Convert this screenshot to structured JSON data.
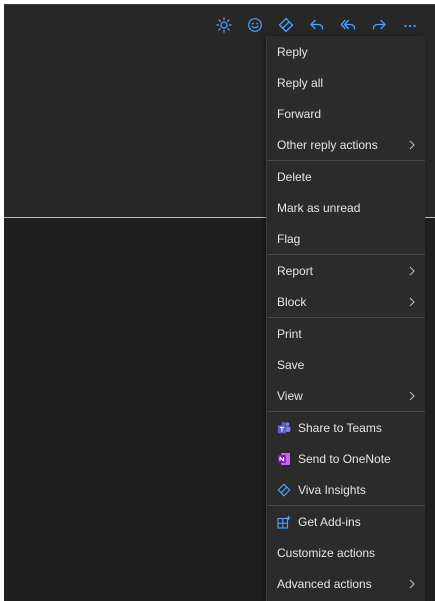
{
  "toolbar": {
    "icons": [
      "sun-icon",
      "emoji-icon",
      "viva-insights-icon",
      "reply-icon",
      "reply-all-icon",
      "forward-icon",
      "more-icon"
    ],
    "accent_color": "#4aa3ff"
  },
  "menu": {
    "reply": "Reply",
    "reply_all": "Reply all",
    "forward": "Forward",
    "other_reply_actions": "Other reply actions",
    "delete": "Delete",
    "mark_as_unread": "Mark as unread",
    "flag": "Flag",
    "report": "Report",
    "block": "Block",
    "print": "Print",
    "save": "Save",
    "view": "View",
    "share_to_teams": "Share to Teams",
    "send_to_onenote": "Send to OneNote",
    "viva_insights": "Viva Insights",
    "get_add_ins": "Get Add-ins",
    "customize_actions": "Customize actions",
    "advanced_actions": "Advanced actions"
  },
  "colors": {
    "teams": "#5b5fc7",
    "onenote": "#7719aa",
    "viva": "#4aa3ff",
    "addins": "#4aa3ff"
  }
}
